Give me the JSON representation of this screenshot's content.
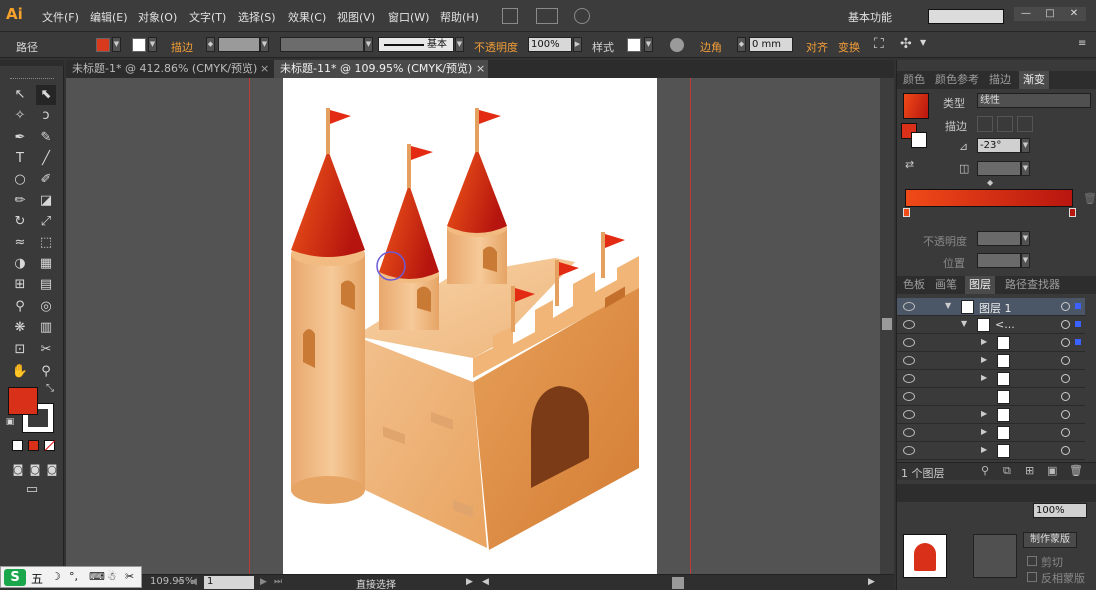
{
  "menubar": {
    "logo": "Ai",
    "items": [
      "文件(F)",
      "编辑(E)",
      "对象(O)",
      "文字(T)",
      "选择(S)",
      "效果(C)",
      "视图(V)",
      "窗口(W)",
      "帮助(H)"
    ],
    "workspace": "基本功能",
    "window_buttons": [
      "—",
      "□",
      "✕"
    ]
  },
  "controlbar": {
    "object_type": "路径",
    "stroke_label": "描边",
    "stroke_style": "基本",
    "opacity_label": "不透明度",
    "opacity_value": "100%",
    "style_label": "样式",
    "corner_label": "边角",
    "corner_value": "0 mm",
    "align_label": "对齐",
    "transform_label": "变换",
    "fill_color": "#d93a1d"
  },
  "doc_tabs": [
    {
      "label": "未标题-1* @ 412.86% (CMYK/预览)",
      "active": false
    },
    {
      "label": "未标题-11* @ 109.95% (CMYK/预览)",
      "active": true
    }
  ],
  "tools": {
    "icons": [
      "selection-icon",
      "direct-selection-icon",
      "magic-wand-icon",
      "lasso-icon",
      "pen-icon",
      "curvature-icon",
      "type-icon",
      "line-icon",
      "ellipse-icon",
      "paintbrush-icon",
      "pencil-icon",
      "eraser-icon",
      "rotate-icon",
      "scale-icon",
      "warp-icon",
      "free-transform-icon",
      "shape-builder-icon",
      "perspective-icon",
      "mesh-icon",
      "gradient-icon",
      "eyedropper-icon",
      "blend-icon",
      "symbol-sprayer-icon",
      "column-graph-icon",
      "artboard-icon",
      "slice-icon",
      "hand-icon",
      "zoom-icon"
    ],
    "fill_color": "#d9301a",
    "stroke_color": "#ffffff"
  },
  "status": {
    "zoom": "109.95%",
    "artboard": "1",
    "tool_name": "直接选择"
  },
  "ime": {
    "label": "五"
  },
  "gradient_panel": {
    "tabs": [
      "颜色",
      "颜色参考",
      "描边",
      "渐变"
    ],
    "type_label": "类型",
    "type_value": "线性",
    "stroke_label": "描边",
    "angle_value": "-23°",
    "opacity_label": "不透明度",
    "position_label": "位置",
    "gradient_start": "#f04a18",
    "gradient_end": "#b8160f"
  },
  "layers_panel": {
    "tabs": [
      "色板",
      "画笔",
      "图层",
      "路径查找器"
    ],
    "rows": [
      {
        "name": "图层 1",
        "expanded": true
      },
      {
        "name": "<...",
        "expanded": true
      },
      {
        "name": ""
      },
      {
        "name": ""
      },
      {
        "name": ""
      },
      {
        "name": ""
      },
      {
        "name": ""
      },
      {
        "name": ""
      },
      {
        "name": ""
      }
    ],
    "footer": "1 个图层"
  },
  "transparency_panel": {
    "opacity_value": "100%",
    "make_mask_button": "制作蒙版",
    "invert_mask": "反相蒙版",
    "clip": "剪切"
  }
}
